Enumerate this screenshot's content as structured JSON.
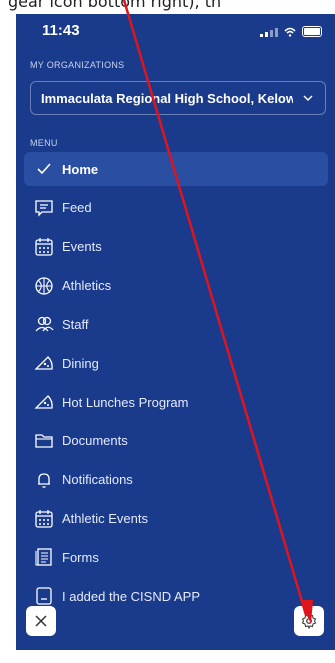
{
  "top_caption": "gear icon bottom right), th",
  "status": {
    "time": "11:43"
  },
  "organizations": {
    "label": "MY ORGANIZATIONS",
    "selected": "Immaculata Regional High School, Kelow"
  },
  "menu": {
    "label": "MENU",
    "items": [
      {
        "label": "Home",
        "icon": "checkmark-icon",
        "active": true
      },
      {
        "label": "Feed",
        "icon": "chat-icon"
      },
      {
        "label": "Events",
        "icon": "calendar-icon"
      },
      {
        "label": "Athletics",
        "icon": "basketball-icon"
      },
      {
        "label": "Staff",
        "icon": "people-icon"
      },
      {
        "label": "Dining",
        "icon": "pizza-icon"
      },
      {
        "label": "Hot Lunches Program",
        "icon": "pizza-icon"
      },
      {
        "label": "Documents",
        "icon": "folder-icon"
      },
      {
        "label": "Notifications",
        "icon": "bell-icon"
      },
      {
        "label": "Athletic Events",
        "icon": "calendar-icon"
      },
      {
        "label": "Forms",
        "icon": "document-icon"
      },
      {
        "label": "I added the CISND APP",
        "icon": "document-icon"
      }
    ]
  },
  "colors": {
    "panel": "#1a3a8c",
    "active": "#2a4ea2",
    "arrow": "#e0141c"
  }
}
